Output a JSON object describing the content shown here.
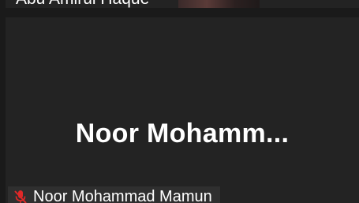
{
  "top_tile": {
    "name": "Abu Amirul Haque"
  },
  "main_tile": {
    "display_name": "Noor Mohamm...",
    "name_label": "Noor Mohammad Mamun",
    "mic_icon": "mic-muted-icon",
    "mic_color": "#e02828"
  }
}
